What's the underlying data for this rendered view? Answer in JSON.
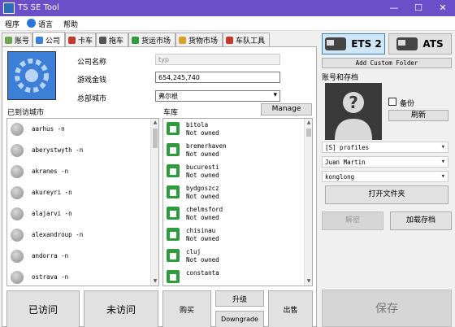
{
  "window": {
    "title": "TS SE Tool",
    "minimize": "—",
    "maximize": "☐",
    "close": "✕"
  },
  "menu": [
    {
      "label": "程序"
    },
    {
      "label": "语言"
    },
    {
      "label": "帮助"
    }
  ],
  "tabs": [
    {
      "label": "账号"
    },
    {
      "label": "公司"
    },
    {
      "label": "卡车"
    },
    {
      "label": "拖车"
    },
    {
      "label": "货运市场"
    },
    {
      "label": "货物市场"
    },
    {
      "label": "车队工具"
    }
  ],
  "company": {
    "name_label": "公司名称",
    "name_value": "typ",
    "money_label": "游戏金钱",
    "money_value": "654,245,740",
    "hq_label": "总部城市",
    "hq_value": "弗尔根"
  },
  "visited": {
    "header": "已到访城市",
    "cities": [
      "aarhus -n",
      "aberystwyth -n",
      "akranes -n",
      "akureyri -n",
      "alajarvi -n",
      "alexandroup -n",
      "andorra -n",
      "ostrava -n"
    ]
  },
  "garages": {
    "header": "车库",
    "manage_label": "Manage",
    "items": [
      {
        "name": "bitola",
        "status": "Not owned"
      },
      {
        "name": "bremerhaven",
        "status": "Not owned"
      },
      {
        "name": "bucuresti",
        "status": "Not owned"
      },
      {
        "name": "bydgoszcz",
        "status": "Not owned"
      },
      {
        "name": "chelmsford",
        "status": "Not owned"
      },
      {
        "name": "chisinau",
        "status": "Not owned"
      },
      {
        "name": "cluj",
        "status": "Not owned"
      },
      {
        "name": "constanta",
        "status": ""
      }
    ]
  },
  "bottom_buttons": {
    "visited": "已访问",
    "unvisited": "未访问",
    "buy": "购买",
    "upgrade": "升级",
    "downgrade": "Downgrade",
    "sell": "出售"
  },
  "right": {
    "ets2": "ETS 2",
    "ats": "ATS",
    "add_custom_folder": "Add Custom Folder",
    "profile_header": "账号和存档",
    "backup_label": "备份",
    "refresh_label": "刷新",
    "profile_type": "[S] profiles",
    "profile_name": "Juan Martin",
    "save_name": "konglong",
    "open_folder": "打开文件夹",
    "decode": "解密",
    "load_save": "加载存档",
    "save": "保存"
  }
}
